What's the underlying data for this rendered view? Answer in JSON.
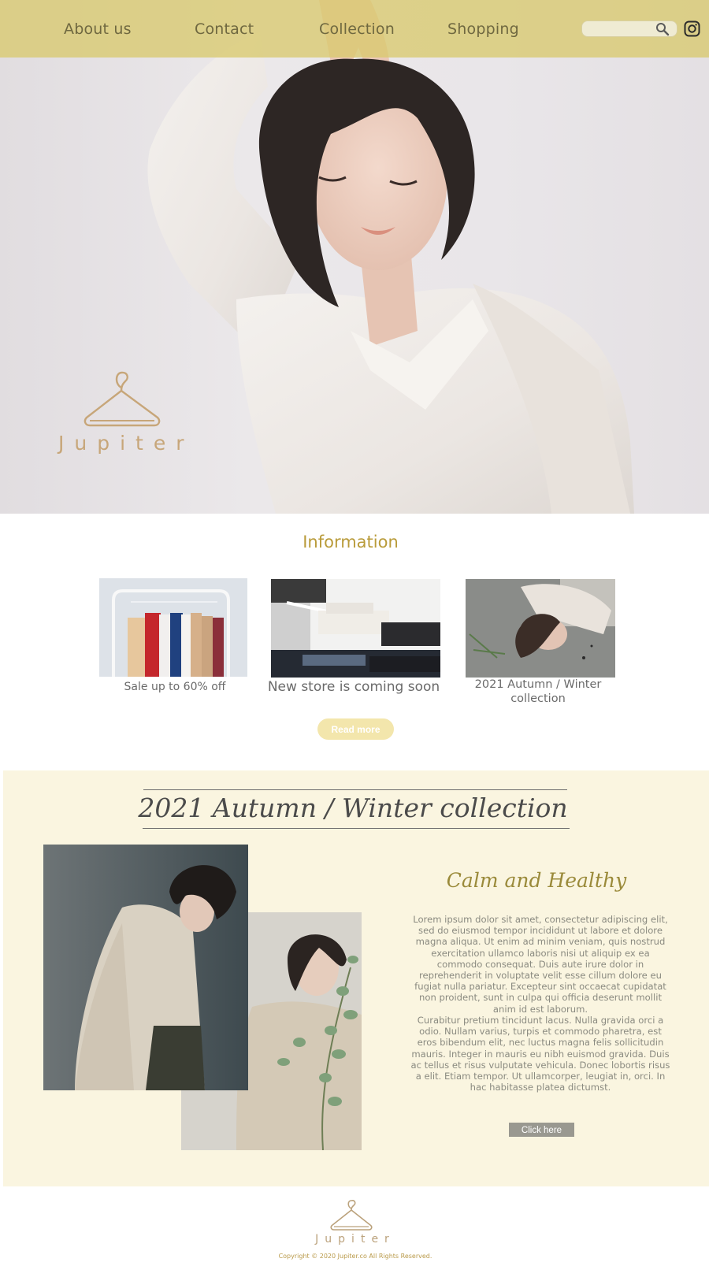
{
  "nav": {
    "items": [
      {
        "label": "About us"
      },
      {
        "label": "Contact"
      },
      {
        "label": "Collection"
      },
      {
        "label": "Shopping"
      }
    ],
    "search_placeholder": "",
    "search_icon": "search-icon",
    "social_icon": "instagram-icon"
  },
  "hero": {
    "brand_name": "Jupiter",
    "logo_icon": "hanger-icon"
  },
  "information": {
    "title": "Information",
    "cards": [
      {
        "caption": "Sale up to 60% off"
      },
      {
        "caption": "New store is coming soon"
      },
      {
        "caption": "2021 Autumn / Winter collection"
      }
    ],
    "read_more": "Read more"
  },
  "collection": {
    "title": "2021 Autumn / Winter collection",
    "subtitle": "Calm and Healthy",
    "paragraph1": "Lorem ipsum dolor sit amet, consectetur adipiscing elit, sed do eiusmod tempor incididunt ut labore et dolore magna aliqua. Ut enim ad minim veniam, quis nostrud exercitation ullamco laboris nisi ut aliquip ex ea commodo consequat. Duis aute irure dolor in reprehenderit in voluptate velit esse cillum dolore eu fugiat nulla pariatur. Excepteur sint occaecat cupidatat non proident, sunt in culpa qui officia deserunt mollit anim id est laborum.",
    "paragraph2": "Curabitur pretium tincidunt lacus. Nulla gravida orci a odio. Nullam varius, turpis et commodo pharetra, est eros bibendum elit, nec luctus magna felis sollicitudin mauris. Integer in mauris eu nibh euismod gravida. Duis ac tellus et risus vulputate vehicula. Donec lobortis risus a elit. Etiam tempor. Ut ullamcorper, leugiat in, orci. In hac habitasse platea dictumst.",
    "button": "Click here"
  },
  "footer": {
    "brand_name": "Jupiter",
    "copyright": "Copyright © 2020 Jupiter.co  All Rights Reserved."
  },
  "colors": {
    "nav_bg": "#d8c96e",
    "accent_gold": "#b99b3a",
    "collection_bg": "#faf5e0",
    "read_more_bg": "#f3e6ac"
  }
}
